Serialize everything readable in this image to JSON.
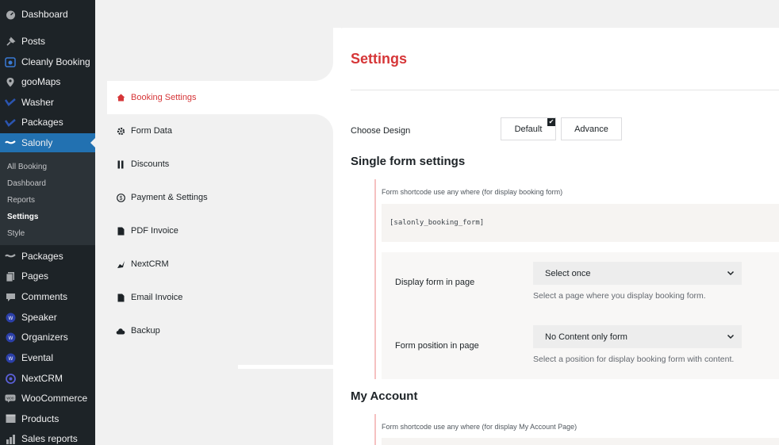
{
  "sidebar": {
    "items": [
      {
        "label": "Dashboard",
        "icon": "dashboard-icon"
      },
      {
        "label": "Posts",
        "icon": "pin-icon"
      },
      {
        "label": "Cleanly Booking",
        "icon": "booking-icon"
      },
      {
        "label": "gooMaps",
        "icon": "map-pin-icon"
      },
      {
        "label": "Washer",
        "icon": "washer-icon"
      },
      {
        "label": "Packages",
        "icon": "package-icon"
      },
      {
        "label": "Salonly",
        "icon": "salonly-icon"
      },
      {
        "label": "Packages",
        "icon": "package-icon"
      },
      {
        "label": "Pages",
        "icon": "pages-icon"
      },
      {
        "label": "Comments",
        "icon": "comment-icon"
      },
      {
        "label": "Speaker",
        "icon": "speaker-icon"
      },
      {
        "label": "Organizers",
        "icon": "organizers-icon"
      },
      {
        "label": "Evental",
        "icon": "evental-icon"
      },
      {
        "label": "NextCRM",
        "icon": "nextcrm-icon"
      },
      {
        "label": "WooCommerce",
        "icon": "woocommerce-icon"
      },
      {
        "label": "Products",
        "icon": "products-icon"
      },
      {
        "label": "Sales reports",
        "icon": "chart-icon"
      }
    ],
    "submenu": [
      "All Booking",
      "Dashboard",
      "Reports",
      "Settings",
      "Style"
    ]
  },
  "tabs": [
    {
      "label": "Booking Settings",
      "icon": "home-icon"
    },
    {
      "label": "Form Data",
      "icon": "gear-icon"
    },
    {
      "label": "Discounts",
      "icon": "discount-icon"
    },
    {
      "label": "Payment & Settings",
      "icon": "dollar-icon"
    },
    {
      "label": "PDF Invoice",
      "icon": "document-icon"
    },
    {
      "label": "NextCRM",
      "icon": "crm-icon"
    },
    {
      "label": "Email Invoice",
      "icon": "document-icon"
    },
    {
      "label": "Backup",
      "icon": "cloud-icon"
    }
  ],
  "content": {
    "title": "Settings",
    "choose_design_label": "Choose Design",
    "design_default": "Default",
    "design_advance": "Advance",
    "single_form_title": "Single form settings",
    "form_shortcode_label": "Form shortcode use any where (for display booking form)",
    "form_shortcode": "[salonly_booking_form]",
    "display_form_label": "Display form in page",
    "display_form_value": "Select once",
    "display_form_help": "Select a page where you display booking form.",
    "position_label": "Form position in page",
    "position_value": "No Content only form",
    "position_help": "Select a position for display booking form with content.",
    "my_account_title": "My Account",
    "account_shortcode_label": "Form shortcode use any where (for display My Account Page)"
  },
  "colors": {
    "accent": "#d63638",
    "wp_blue": "#2271b1",
    "sidebar": "#1d2327"
  }
}
